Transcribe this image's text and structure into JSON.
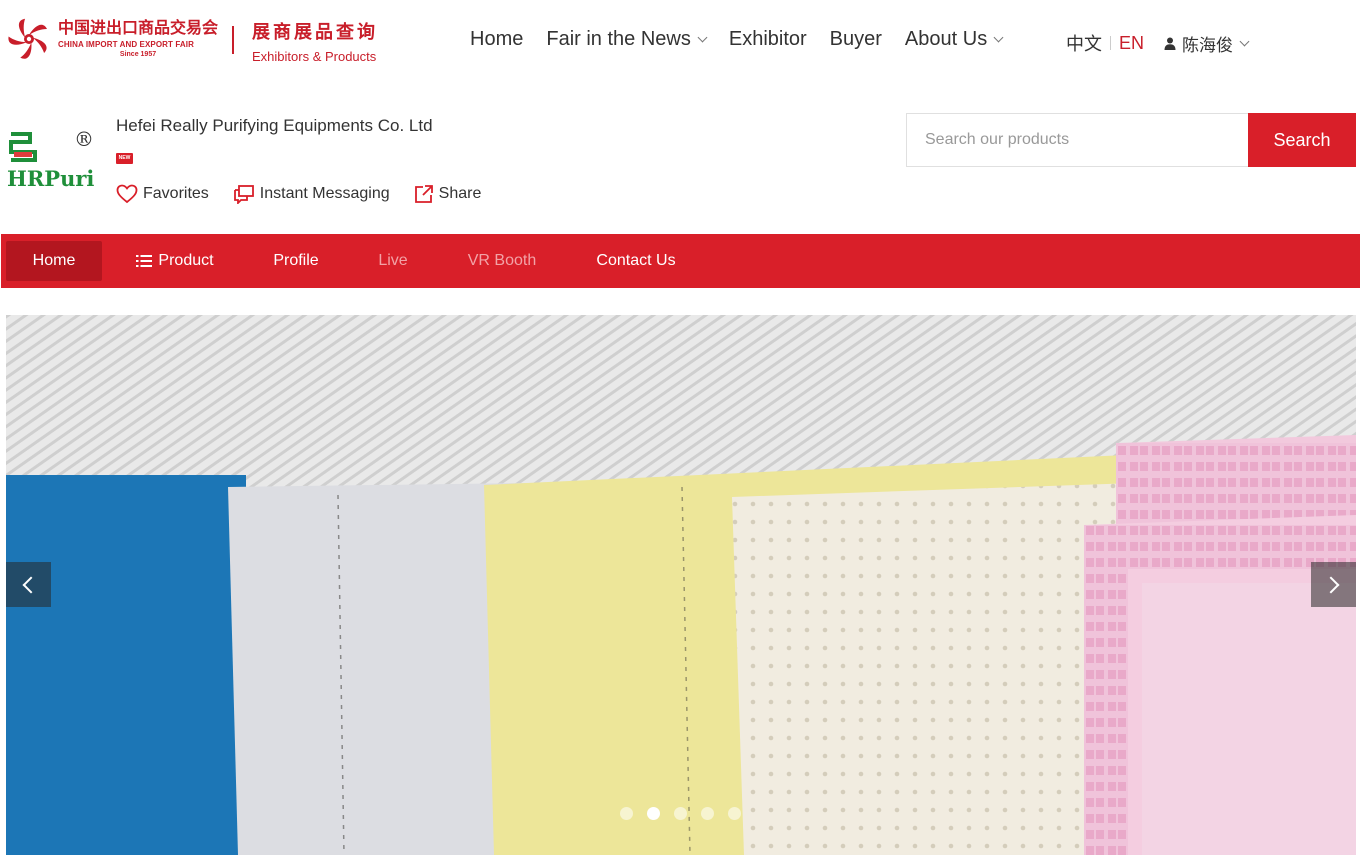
{
  "header": {
    "fair_logo": {
      "name_cn": "中国进出口商品交易会",
      "name_en": "CHINA IMPORT AND EXPORT FAIR",
      "since": "Since 1957",
      "color": "#c81e2a"
    },
    "subbrand": {
      "title_cn": "展商展品查询",
      "title_en": "Exhibitors & Products"
    },
    "nav": [
      {
        "label": "Home"
      },
      {
        "label": "Fair in the News",
        "has_dropdown": true
      },
      {
        "label": "Exhibitor"
      },
      {
        "label": "Buyer"
      },
      {
        "label": "About Us",
        "has_dropdown": true
      }
    ],
    "lang": {
      "cn": "中文",
      "en": "EN",
      "active": "EN"
    },
    "user": {
      "name": "陈海俊",
      "icon": "user-icon"
    }
  },
  "company": {
    "logo_text": "HRPuri",
    "logo_mark": "®",
    "name": "Hefei Really Purifying Equipments Co. Ltd",
    "badge": "NEW",
    "actions": [
      {
        "label": "Favorites",
        "icon": "heart-icon"
      },
      {
        "label": "Instant Messaging",
        "icon": "chat-icon"
      },
      {
        "label": "Share",
        "icon": "share-icon"
      }
    ]
  },
  "search": {
    "placeholder": "Search our products",
    "button_label": "Search"
  },
  "shop_nav": {
    "tabs": [
      {
        "label": "Home",
        "state": "active"
      },
      {
        "label": "Product",
        "icon": "list-icon"
      },
      {
        "label": "Profile"
      },
      {
        "label": "Live",
        "state": "disabled"
      },
      {
        "label": "VR Booth",
        "state": "disabled"
      },
      {
        "label": "Contact Us"
      }
    ],
    "color": "#d91f29"
  },
  "carousel": {
    "slide_count": 5,
    "active_index": 1,
    "prev_icon": "chevron-left-icon",
    "next_icon": "chevron-right-icon"
  }
}
